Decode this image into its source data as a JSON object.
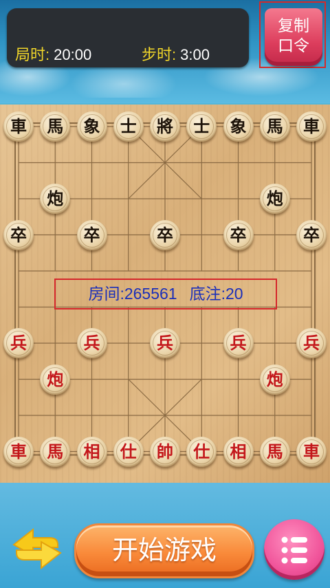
{
  "timer": {
    "game_label": "局时:",
    "game_value": "20:00",
    "step_label": "步时:",
    "step_value": "3:00"
  },
  "copy_button": {
    "line1": "复制",
    "line2": "口令"
  },
  "room_info": {
    "room": "房间:265561",
    "stake": "底注:20"
  },
  "start_button": {
    "label": "开始游戏"
  },
  "colors": {
    "accent_red": "#d4262b",
    "room_text": "#1b2fb9",
    "timer_label": "#f2d72a"
  },
  "board": {
    "pieces": [
      {
        "side": "black",
        "char": "車",
        "col": 0,
        "row": 0
      },
      {
        "side": "black",
        "char": "馬",
        "col": 1,
        "row": 0
      },
      {
        "side": "black",
        "char": "象",
        "col": 2,
        "row": 0
      },
      {
        "side": "black",
        "char": "士",
        "col": 3,
        "row": 0
      },
      {
        "side": "black",
        "char": "將",
        "col": 4,
        "row": 0
      },
      {
        "side": "black",
        "char": "士",
        "col": 5,
        "row": 0
      },
      {
        "side": "black",
        "char": "象",
        "col": 6,
        "row": 0
      },
      {
        "side": "black",
        "char": "馬",
        "col": 7,
        "row": 0
      },
      {
        "side": "black",
        "char": "車",
        "col": 8,
        "row": 0
      },
      {
        "side": "black",
        "char": "炮",
        "col": 1,
        "row": 2
      },
      {
        "side": "black",
        "char": "炮",
        "col": 7,
        "row": 2
      },
      {
        "side": "black",
        "char": "卒",
        "col": 0,
        "row": 3
      },
      {
        "side": "black",
        "char": "卒",
        "col": 2,
        "row": 3
      },
      {
        "side": "black",
        "char": "卒",
        "col": 4,
        "row": 3
      },
      {
        "side": "black",
        "char": "卒",
        "col": 6,
        "row": 3
      },
      {
        "side": "black",
        "char": "卒",
        "col": 8,
        "row": 3
      },
      {
        "side": "red",
        "char": "兵",
        "col": 0,
        "row": 6
      },
      {
        "side": "red",
        "char": "兵",
        "col": 2,
        "row": 6
      },
      {
        "side": "red",
        "char": "兵",
        "col": 4,
        "row": 6
      },
      {
        "side": "red",
        "char": "兵",
        "col": 6,
        "row": 6
      },
      {
        "side": "red",
        "char": "兵",
        "col": 8,
        "row": 6
      },
      {
        "side": "red",
        "char": "炮",
        "col": 1,
        "row": 7
      },
      {
        "side": "red",
        "char": "炮",
        "col": 7,
        "row": 7
      },
      {
        "side": "red",
        "char": "車",
        "col": 0,
        "row": 9
      },
      {
        "side": "red",
        "char": "馬",
        "col": 1,
        "row": 9
      },
      {
        "side": "red",
        "char": "相",
        "col": 2,
        "row": 9
      },
      {
        "side": "red",
        "char": "仕",
        "col": 3,
        "row": 9
      },
      {
        "side": "red",
        "char": "帥",
        "col": 4,
        "row": 9
      },
      {
        "side": "red",
        "char": "仕",
        "col": 5,
        "row": 9
      },
      {
        "side": "red",
        "char": "相",
        "col": 6,
        "row": 9
      },
      {
        "side": "red",
        "char": "馬",
        "col": 7,
        "row": 9
      },
      {
        "side": "red",
        "char": "車",
        "col": 8,
        "row": 9
      }
    ]
  },
  "icons": {
    "side_button": "swap-arrows-icon",
    "menu_button": "menu-list-icon"
  }
}
